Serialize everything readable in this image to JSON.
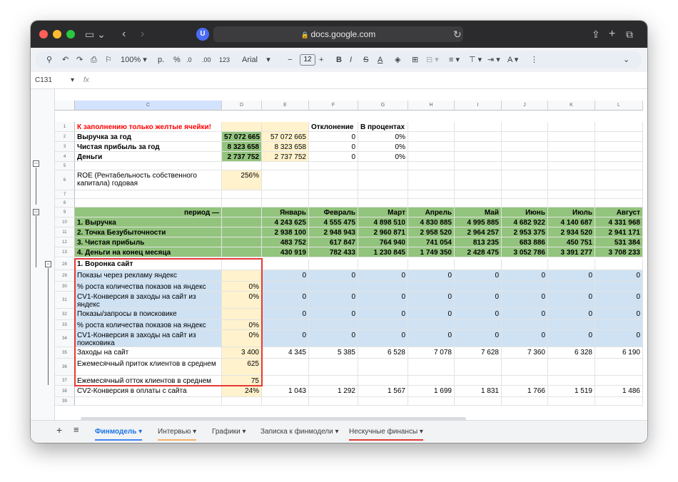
{
  "browser": {
    "url": "docs.google.com",
    "icons": [
      "sidebar-icon",
      "chevron-left-icon",
      "chevron-right-icon",
      "shield-icon",
      "lock-icon",
      "reload-icon",
      "share-icon",
      "new-tab-icon",
      "tabs-icon"
    ],
    "shield_glyph": "U"
  },
  "toolbar": {
    "zoom": "100%",
    "currency": "р.",
    "percent": "%",
    "dec_decrease": ".0",
    "dec_increase": ".00",
    "number_format": "123",
    "font": "Arial",
    "minus": "−",
    "font_size": "12",
    "plus": "+",
    "bold": "B",
    "italic": "I",
    "strike": "S",
    "text_color": "A",
    "more": "⋮"
  },
  "formula_bar": {
    "cell_ref": "C131",
    "fx": "fx"
  },
  "columns": [
    {
      "key": "C",
      "label": "C"
    },
    {
      "key": "D",
      "label": "D"
    },
    {
      "key": "E",
      "label": "E"
    },
    {
      "key": "F",
      "label": "F"
    },
    {
      "key": "G",
      "label": "G"
    },
    {
      "key": "H",
      "label": "H"
    },
    {
      "key": "I",
      "label": "I"
    },
    {
      "key": "J",
      "label": "J"
    },
    {
      "key": "K",
      "label": "K"
    },
    {
      "key": "L",
      "label": "L"
    }
  ],
  "rows": [
    {
      "n": "1",
      "c": "К заполнению только желтые ячейки!",
      "d": "",
      "e": "",
      "f": "Отклонение",
      "g": "В процентах",
      "months": []
    },
    {
      "n": "2",
      "c": "Выручка за год",
      "d": "57 072 665",
      "e": "57 072 665",
      "f": "0",
      "g": "0%",
      "months": []
    },
    {
      "n": "3",
      "c": "Чистая прибыль за год",
      "d": "8 323 658",
      "e": "8 323 658",
      "f": "0",
      "g": "0%",
      "months": []
    },
    {
      "n": "4",
      "c": "Деньги",
      "d": "2 737 752",
      "e": "2 737 752",
      "f": "0",
      "g": "0%",
      "months": []
    },
    {
      "n": "5",
      "c": "",
      "d": "",
      "e": "",
      "f": "",
      "g": "",
      "months": []
    },
    {
      "n": "6",
      "c": "ROE (Рентабельность собственного капитала) годовая",
      "d": "256%",
      "e": "",
      "f": "",
      "g": "",
      "months": []
    },
    {
      "n": "7",
      "c": "",
      "d": "",
      "e": "",
      "f": "",
      "g": "",
      "months": []
    },
    {
      "n": "8",
      "c": "",
      "d": "",
      "e": "",
      "f": "",
      "g": "",
      "months": []
    },
    {
      "n": "9",
      "c": "период —",
      "d": "",
      "months": [
        "Январь",
        "Февраль",
        "Март",
        "Апрель",
        "Май",
        "Июнь",
        "Июль",
        "Август"
      ]
    },
    {
      "n": "10",
      "c": "1. Выручка",
      "d": "",
      "months": [
        "4 243 625",
        "4 555 475",
        "4 898 510",
        "4 830 885",
        "4 995 885",
        "4 682 922",
        "4 140 687",
        "4 331 968"
      ]
    },
    {
      "n": "11",
      "c": "2. Точка Безубыточности",
      "d": "",
      "months": [
        "2 938 100",
        "2 948 943",
        "2 960 871",
        "2 958 520",
        "2 964 257",
        "2 953 375",
        "2 934 520",
        "2 941 171"
      ]
    },
    {
      "n": "12",
      "c": "3. Чистая прибыль",
      "d": "",
      "months": [
        "483 752",
        "617 847",
        "764 940",
        "741 054",
        "813 235",
        "683 886",
        "450 751",
        "531 384"
      ]
    },
    {
      "n": "13",
      "c": "4. Деньги на конец месяца",
      "d": "",
      "months": [
        "430 919",
        "782 433",
        "1 230 845",
        "1 749 350",
        "2 428 475",
        "3 052 786",
        "3 391 277",
        "3 708 233"
      ]
    },
    {
      "n": "28",
      "c": "1. Воронка сайт",
      "d": "",
      "months": []
    },
    {
      "n": "29",
      "c": "Показы через рекламу яндекс",
      "d": "",
      "months": [
        "0",
        "0",
        "0",
        "0",
        "0",
        "0",
        "0",
        "0"
      ]
    },
    {
      "n": "30",
      "c": "% роста количества показов на яндекс",
      "d": "0%",
      "months": []
    },
    {
      "n": "31",
      "c": "CV1-Конверсия в заходы на сайт из яндекс",
      "d": "0%",
      "months": [
        "0",
        "0",
        "0",
        "0",
        "0",
        "0",
        "0",
        "0"
      ]
    },
    {
      "n": "32",
      "c": "Показы/запросы в поисковике",
      "d": "",
      "months": [
        "0",
        "0",
        "0",
        "0",
        "0",
        "0",
        "0",
        "0"
      ]
    },
    {
      "n": "33",
      "c": "% роста количества показов на яндекс",
      "d": "0%",
      "months": []
    },
    {
      "n": "34",
      "c": "CV1-Конверсия в заходы на сайт из поисковика",
      "d": "0%",
      "months": [
        "0",
        "0",
        "0",
        "0",
        "0",
        "0",
        "0",
        "0"
      ]
    },
    {
      "n": "35",
      "c": "Заходы на сайт",
      "d": "3 400",
      "months": [
        "4 345",
        "5 385",
        "6 528",
        "7 078",
        "7 628",
        "7 360",
        "6 328",
        "6 190"
      ]
    },
    {
      "n": "36",
      "c": "Ежемесячный приток клиентов в среднем",
      "d": "625",
      "months": []
    },
    {
      "n": "37",
      "c": "Ежемесячный отток клиентов в среднем",
      "d": "75",
      "months": []
    },
    {
      "n": "38",
      "c": "CV2-Конверсия в оплаты с сайта",
      "d": "24%",
      "months": [
        "1 043",
        "1 292",
        "1 567",
        "1 699",
        "1 831",
        "1 766",
        "1 519",
        "1 486"
      ]
    },
    {
      "n": "39",
      "c": "",
      "d": "",
      "months": []
    }
  ],
  "sheet_tabs": [
    {
      "label": "Финмодель",
      "active": true,
      "color": "#4285f4"
    },
    {
      "label": "Интервью",
      "active": false,
      "color": "#f6b26b"
    },
    {
      "label": "Графики",
      "active": false,
      "color": ""
    },
    {
      "label": "Записка к финмодели",
      "active": false,
      "color": ""
    },
    {
      "label": "Нескучные финансы",
      "active": false,
      "color": "#e53935"
    }
  ],
  "colors": {
    "green": "#93c47d",
    "yellow": "#fff2cc",
    "blue": "#cfe2f3",
    "red_text": "#ff0000",
    "highlight": "#e53935"
  }
}
